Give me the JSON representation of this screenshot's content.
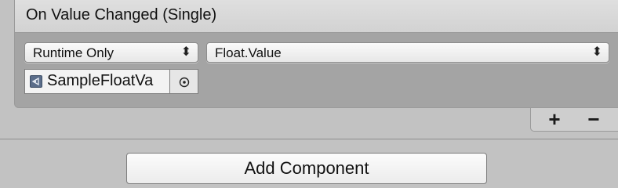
{
  "event": {
    "title": "On Value Changed (Single)",
    "call_state": {
      "selected": "Runtime Only",
      "arrows_icon": "up-down-arrows-icon"
    },
    "function": {
      "selected": "Float.Value",
      "arrows_icon": "up-down-arrows-icon"
    },
    "target_object": {
      "name": "SampleFloatVa",
      "icon": "scriptable-object-icon",
      "picker_icon": "object-picker-icon"
    }
  },
  "footer": {
    "add_label": "+",
    "remove_label": "−"
  },
  "add_component_label": "Add Component",
  "colors": {
    "background": "#c2c2c2",
    "panel": "#a4a4a4",
    "header": "#d9d9d9"
  }
}
